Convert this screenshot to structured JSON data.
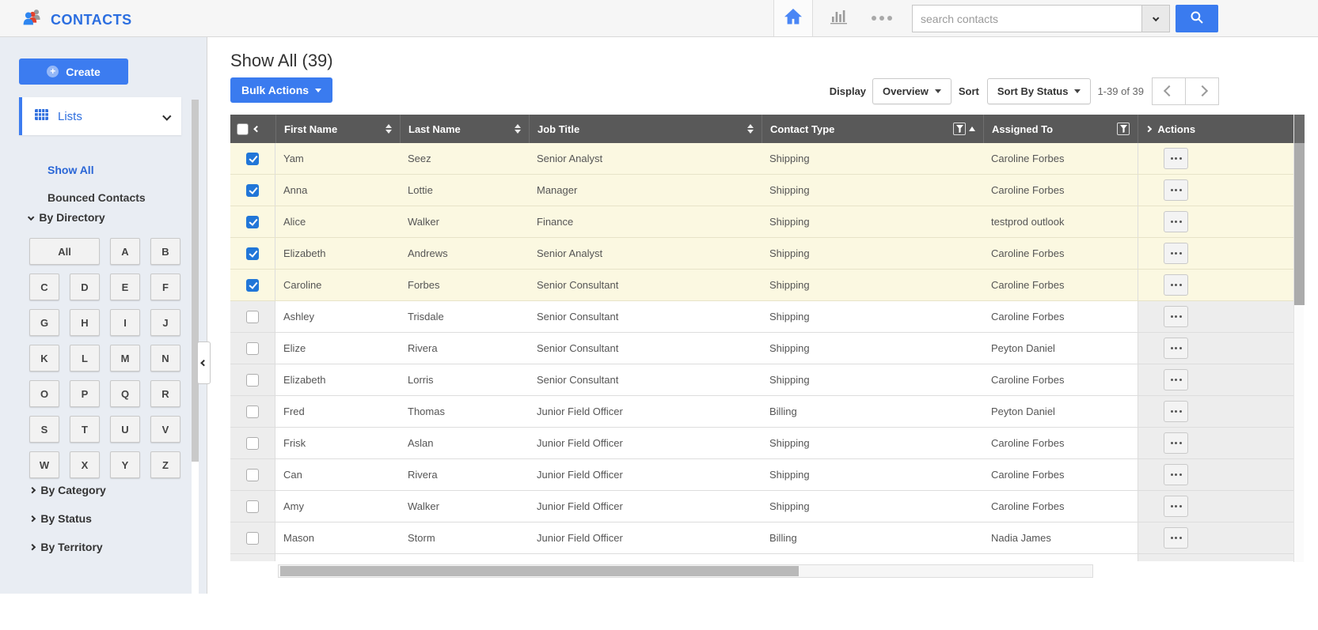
{
  "topbar": {
    "app_title": "CONTACTS",
    "search_placeholder": "search contacts"
  },
  "icons": {
    "logo": "people-group",
    "home": "home",
    "stats": "bar-chart",
    "more": "ellipsis",
    "search": "magnifier",
    "create_plus": "plus-circle",
    "lists": "grid",
    "filter": "funnel",
    "row_menu": "ellipsis"
  },
  "colors": {
    "accent_blue": "#3c7cf0",
    "title_blue": "#2b6ee0",
    "table_header_gray": "#595959",
    "selected_row_yellow": "#fbf8e1",
    "checkbox_checked_blue": "#2176d8"
  },
  "sidebar": {
    "create_label": "Create",
    "lists_label": "Lists",
    "links": [
      {
        "label": "Show All"
      },
      {
        "label": "Bounced Contacts"
      }
    ],
    "sections": {
      "directory": "By Directory",
      "category": "By Category",
      "status": "By Status",
      "territory": "By Territory"
    },
    "directory_letters": [
      "All",
      "A",
      "B",
      "C",
      "D",
      "E",
      "F",
      "G",
      "H",
      "I",
      "J",
      "K",
      "L",
      "M",
      "N",
      "O",
      "P",
      "Q",
      "R",
      "S",
      "T",
      "U",
      "V",
      "W",
      "X",
      "Y",
      "Z"
    ]
  },
  "main": {
    "page_title": "Show All (39)"
  },
  "toolbar": {
    "bulk_actions_label": "Bulk Actions",
    "display_label": "Display",
    "display_value": "Overview",
    "sort_label": "Sort",
    "sort_value": "Sort By Status",
    "range_text": "1-39 of 39"
  },
  "table": {
    "columns": [
      "First Name",
      "Last Name",
      "Job Title",
      "Contact Type",
      "Assigned To",
      "Actions"
    ],
    "rows": [
      {
        "first": "Yam",
        "last": "Seez",
        "job": "Senior Analyst",
        "type": "Shipping",
        "assigned": "Caroline Forbes",
        "checked": true
      },
      {
        "first": "Anna",
        "last": "Lottie",
        "job": "Manager",
        "type": "Shipping",
        "assigned": "Caroline Forbes",
        "checked": true
      },
      {
        "first": "Alice",
        "last": "Walker",
        "job": "Finance",
        "type": "Shipping",
        "assigned": "testprod outlook",
        "checked": true
      },
      {
        "first": "Elizabeth",
        "last": "Andrews",
        "job": "Senior Analyst",
        "type": "Shipping",
        "assigned": "Caroline Forbes",
        "checked": true
      },
      {
        "first": "Caroline",
        "last": "Forbes",
        "job": "Senior Consultant",
        "type": "Shipping",
        "assigned": "Caroline Forbes",
        "checked": true
      },
      {
        "first": "Ashley",
        "last": "Trisdale",
        "job": "Senior Consultant",
        "type": "Shipping",
        "assigned": "Caroline Forbes",
        "checked": false
      },
      {
        "first": "Elize",
        "last": "Rivera",
        "job": "Senior Consultant",
        "type": "Shipping",
        "assigned": "Peyton Daniel",
        "checked": false
      },
      {
        "first": "Elizabeth",
        "last": "Lorris",
        "job": "Senior Consultant",
        "type": "Shipping",
        "assigned": "Caroline Forbes",
        "checked": false
      },
      {
        "first": "Fred",
        "last": "Thomas",
        "job": "Junior Field Officer",
        "type": "Billing",
        "assigned": "Peyton Daniel",
        "checked": false
      },
      {
        "first": "Frisk",
        "last": "Aslan",
        "job": "Junior Field Officer",
        "type": "Shipping",
        "assigned": "Caroline Forbes",
        "checked": false
      },
      {
        "first": "Can",
        "last": "Rivera",
        "job": "Junior Field Officer",
        "type": "Shipping",
        "assigned": "Caroline Forbes",
        "checked": false
      },
      {
        "first": "Amy",
        "last": "Walker",
        "job": "Junior Field Officer",
        "type": "Shipping",
        "assigned": "Caroline Forbes",
        "checked": false
      },
      {
        "first": "Mason",
        "last": "Storm",
        "job": "Junior Field Officer",
        "type": "Billing",
        "assigned": "Nadia James",
        "checked": false
      }
    ]
  }
}
